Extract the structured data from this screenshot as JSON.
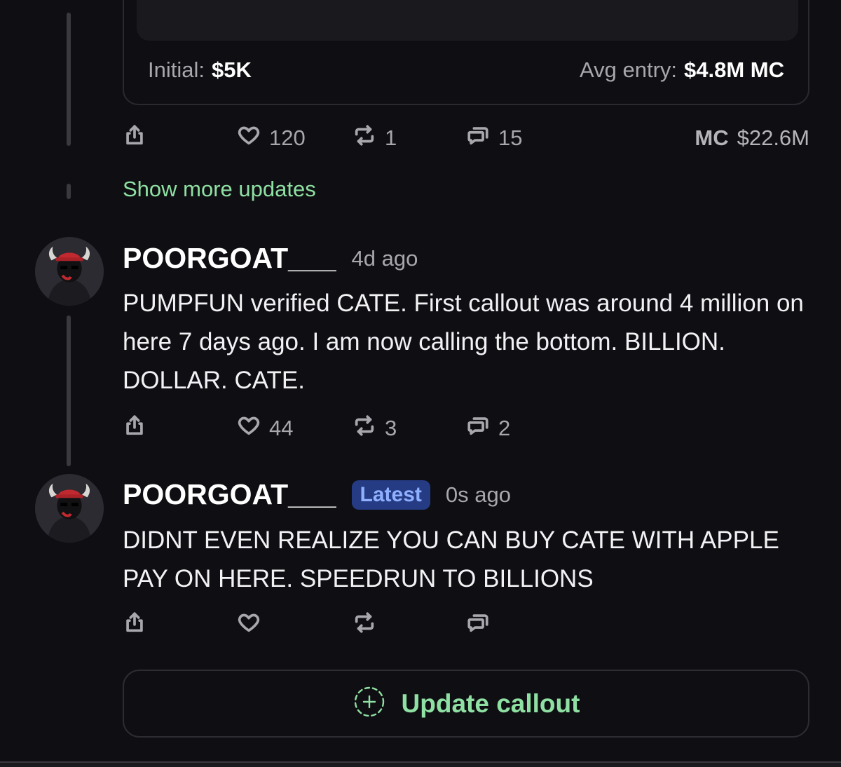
{
  "colors": {
    "background": "#0f0e12",
    "accent_green": "#8fe0a3",
    "badge_bg": "#253c85",
    "badge_text": "#8fb0ff",
    "muted_text": "#a8a7ad"
  },
  "callout_card": {
    "initial_label": "Initial:",
    "initial_value": "$5K",
    "avg_entry_label": "Avg entry:",
    "avg_entry_value": "$4.8M MC"
  },
  "first_actions": {
    "share_icon": "share-icon",
    "likes": "120",
    "reposts": "1",
    "replies": "15",
    "mc_label": "MC",
    "mc_value": "$22.6M"
  },
  "show_more": "Show more updates",
  "posts": [
    {
      "username": "POORGOAT___",
      "time": "4d ago",
      "body": "PUMPFUN verified CATE. First callout was around 4 million on here 7 days ago. I am now calling the bottom. BILLION. DOLLAR. CATE.",
      "likes": "44",
      "reposts": "3",
      "replies": "2"
    },
    {
      "username": "POORGOAT___",
      "badge": "Latest",
      "time": "0s ago",
      "body": "DIDNT EVEN REALIZE YOU CAN BUY CATE WITH APPLE PAY ON HERE. SPEEDRUN TO BILLIONS",
      "likes": "",
      "reposts": "",
      "replies": ""
    }
  ],
  "update_button": {
    "label": "Update callout",
    "icon": "dashed-plus-circle-icon"
  }
}
